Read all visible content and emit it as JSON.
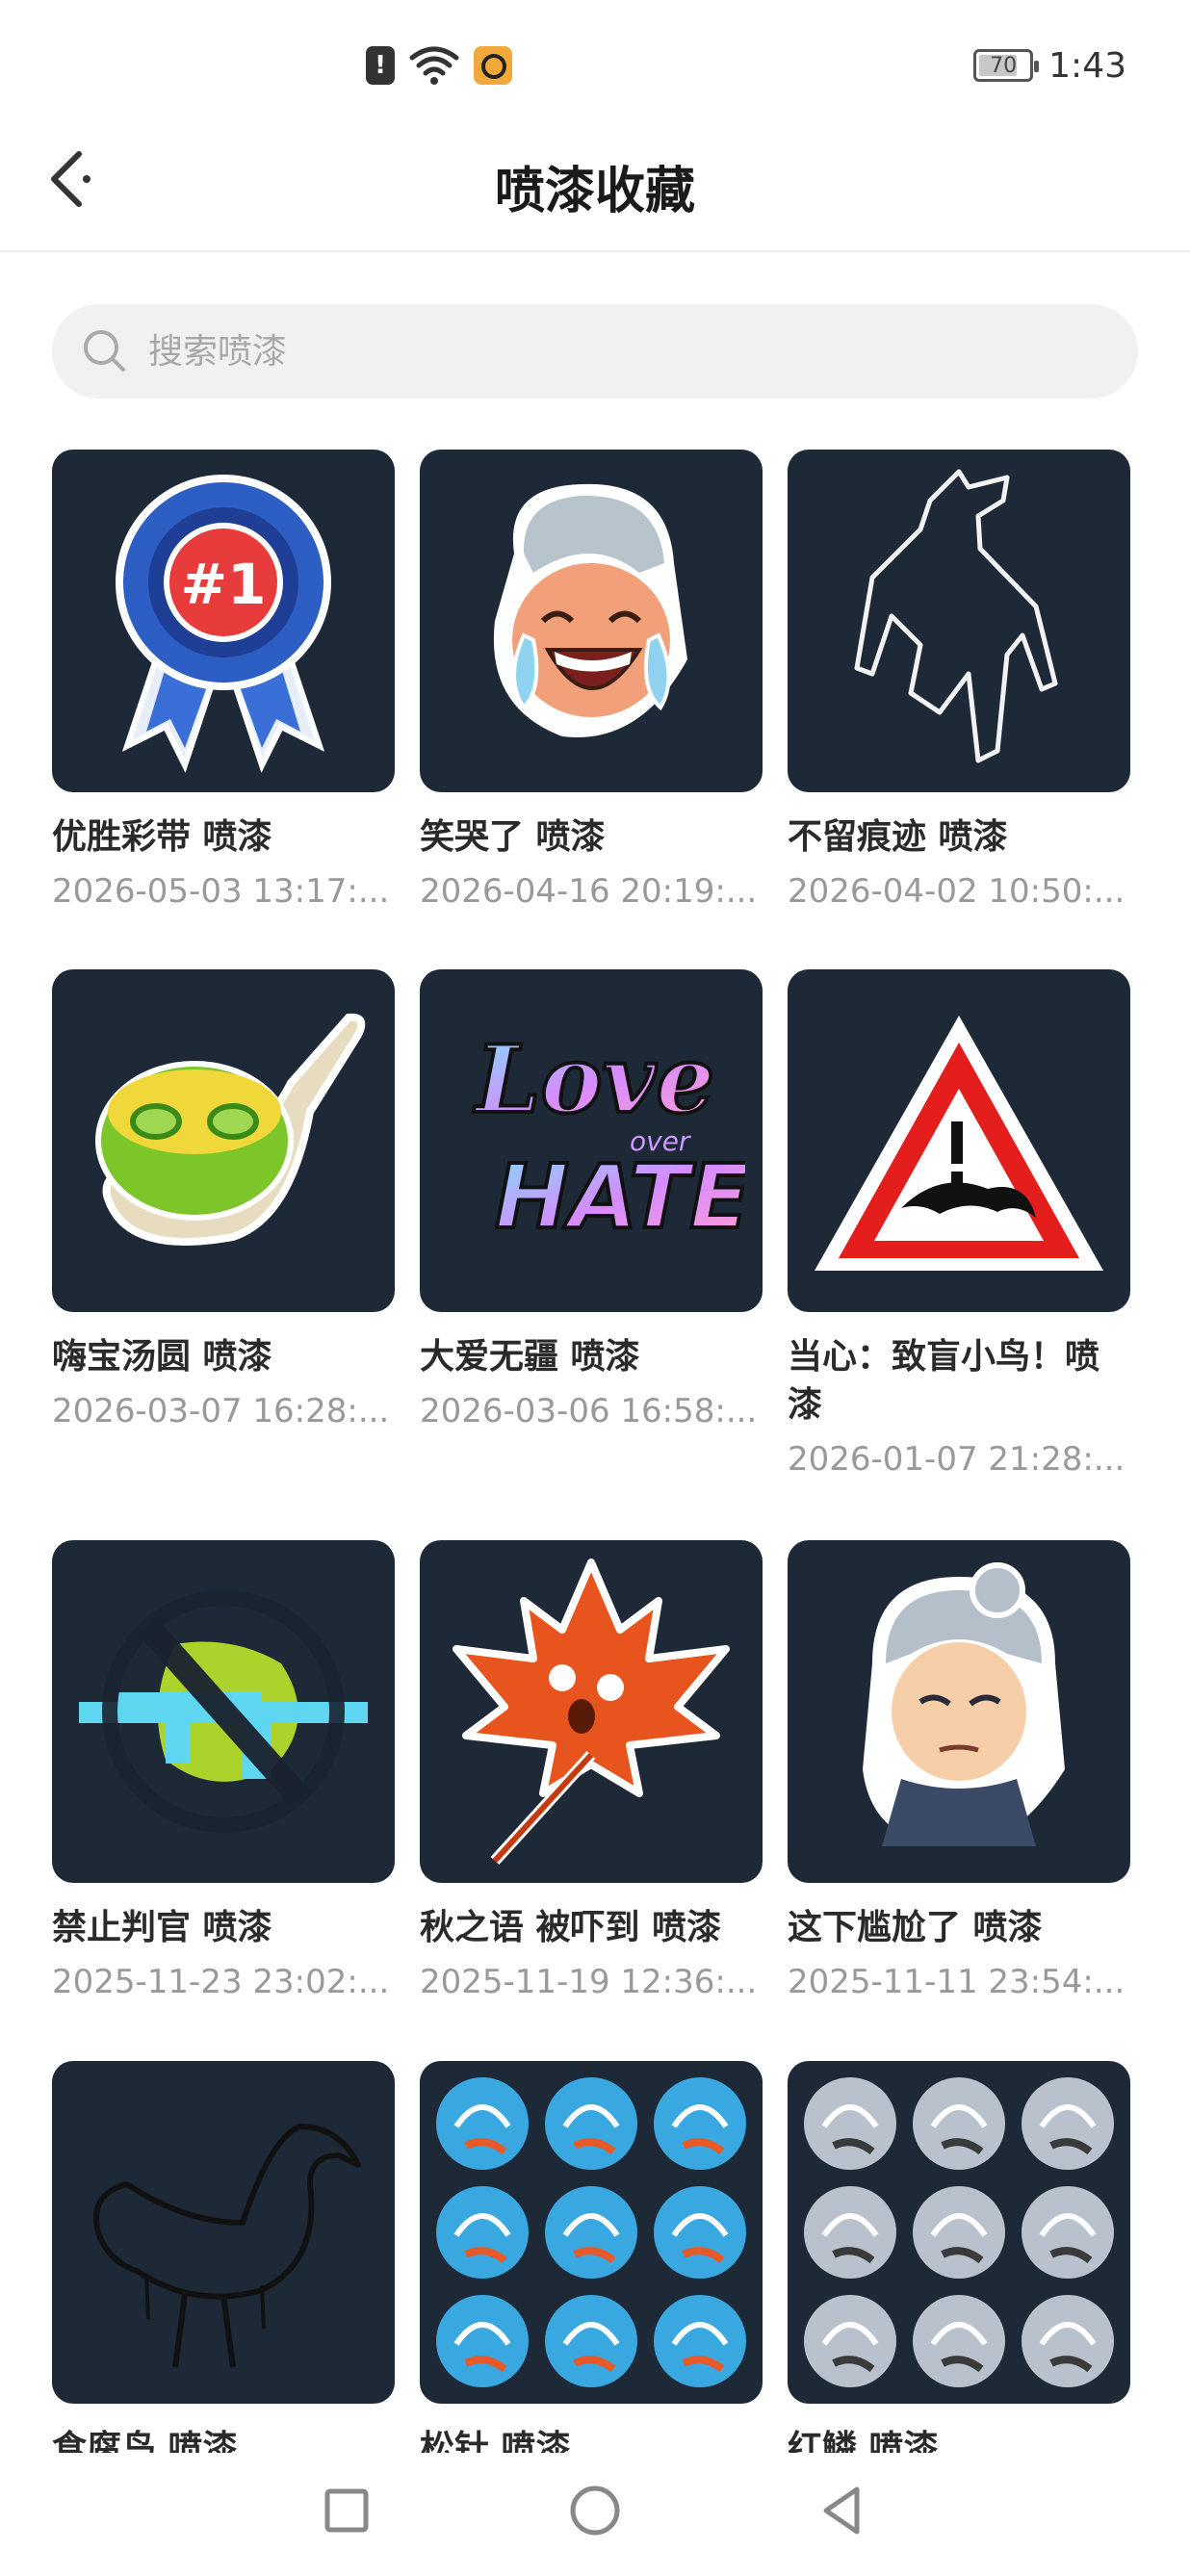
{
  "status_bar": {
    "alert_glyph": "!",
    "battery": "70",
    "time": "1:43"
  },
  "header": {
    "title": "喷漆收藏"
  },
  "search": {
    "placeholder": "搜索喷漆"
  },
  "sprays": [
    {
      "name": "优胜彩带 喷漆",
      "date": "2026-05-03 13:17:..."
    },
    {
      "name": "笑哭了 喷漆",
      "date": "2026-04-16 20:19:..."
    },
    {
      "name": "不留痕迹 喷漆",
      "date": "2026-04-02 10:50:..."
    },
    {
      "name": "嗨宝汤圆 喷漆",
      "date": "2026-03-07 16:28:..."
    },
    {
      "name": "大爱无疆 喷漆",
      "date": "2026-03-06 16:58:..."
    },
    {
      "name": "当心：致盲小鸟！喷漆",
      "date": "2026-01-07 21:28:..."
    },
    {
      "name": "禁止判官 喷漆",
      "date": "2025-11-23 23:02:..."
    },
    {
      "name": "秋之语 被吓到 喷漆",
      "date": "2025-11-19 12:36:..."
    },
    {
      "name": "这下尴尬了 喷漆",
      "date": "2025-11-11 23:54:..."
    },
    {
      "name": "食腐鸟 喷漆",
      "date": ""
    },
    {
      "name": "松针 喷漆",
      "date": ""
    },
    {
      "name": "红鳞 喷漆",
      "date": ""
    }
  ],
  "thumb_text": {
    "ribbon_badge": "#1",
    "love_word": "Love",
    "over_word": "over",
    "hate_word": "HATE"
  },
  "colors": {
    "thumb_bg": "#1e2938",
    "accent": "#222222"
  }
}
